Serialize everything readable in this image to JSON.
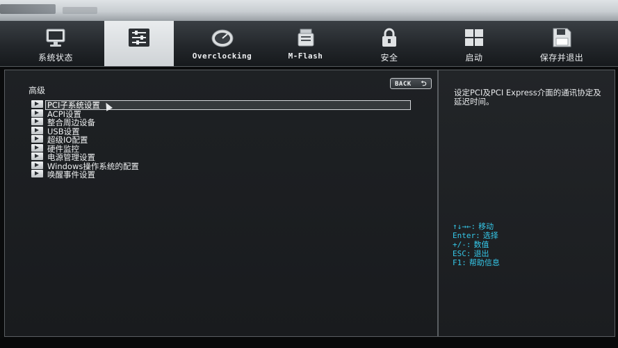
{
  "tabs": [
    {
      "label": "系统状态",
      "icon": "monitor-icon",
      "active": false
    },
    {
      "label": "",
      "icon": "sliders-icon",
      "active": true
    },
    {
      "label": "Overclocking",
      "icon": "speedometer-icon",
      "active": false
    },
    {
      "label": "M-Flash",
      "icon": "flash-drive-icon",
      "active": false
    },
    {
      "label": "安全",
      "icon": "lock-icon",
      "active": false
    },
    {
      "label": "启动",
      "icon": "boot-grid-icon",
      "active": false
    },
    {
      "label": "保存并退出",
      "icon": "floppy-disk-icon",
      "active": false
    }
  ],
  "main": {
    "section_title": "高级",
    "back_label": "BACK",
    "items": [
      {
        "label": "PCI子系统设置",
        "selected": true
      },
      {
        "label": "ACPI设置"
      },
      {
        "label": "整合周边设备"
      },
      {
        "label": "USB设置"
      },
      {
        "label": "超级IO配置"
      },
      {
        "label": "硬件监控"
      },
      {
        "label": "电源管理设置"
      },
      {
        "label": "Windows操作系统的配置"
      },
      {
        "label": "唤醒事件设置"
      }
    ]
  },
  "help": {
    "description": "设定PCI及PCI Express介面的通讯协定及延迟时间。",
    "keys": [
      {
        "key": "↑↓→←:",
        "action": "移动"
      },
      {
        "key": "Enter:",
        "action": "选择"
      },
      {
        "key": "+/-:",
        "action": "数值"
      },
      {
        "key": "ESC:",
        "action": "退出"
      },
      {
        "key": "F1:",
        "action": "帮助信息"
      }
    ]
  },
  "colors": {
    "key_hint": "#35c7e8",
    "active_tab": "#e2e5e7"
  }
}
